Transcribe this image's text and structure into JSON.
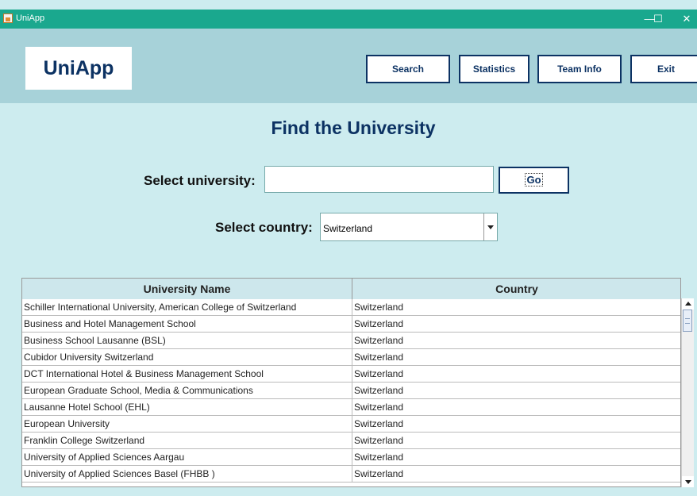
{
  "window": {
    "title": "UniApp",
    "minimize": "—",
    "maximize": "☐",
    "close": "✕"
  },
  "header": {
    "logo": "UniApp",
    "nav": {
      "search": "Search",
      "statistics": "Statistics",
      "team_info": "Team Info",
      "exit": "Exit"
    }
  },
  "main": {
    "title": "Find the University",
    "university_label": "Select university:",
    "university_value": "",
    "go_label": "Go",
    "country_label": "Select country:",
    "country_selected": "Switzerland"
  },
  "table": {
    "columns": [
      "University Name",
      "Country"
    ],
    "rows": [
      [
        "Schiller International University, American College of Switzerland",
        "Switzerland"
      ],
      [
        "Business and Hotel Management School",
        "Switzerland"
      ],
      [
        "Business School Lausanne (BSL)",
        "Switzerland"
      ],
      [
        "Cubidor University Switzerland",
        "Switzerland"
      ],
      [
        "DCT International Hotel & Business Management School",
        "Switzerland"
      ],
      [
        "European Graduate School, Media & Communications",
        "Switzerland"
      ],
      [
        "Lausanne Hotel School (EHL)",
        "Switzerland"
      ],
      [
        "European University",
        "Switzerland"
      ],
      [
        "Franklin College Switzerland",
        "Switzerland"
      ],
      [
        "University of Applied Sciences Aargau",
        "Switzerland"
      ],
      [
        "University of Applied Sciences Basel (FHBB )",
        "Switzerland"
      ]
    ]
  },
  "colors": {
    "titlebar": "#1aa88e",
    "header_band": "#a7d2d9",
    "background": "#cdecef",
    "accent": "#0c3263"
  }
}
